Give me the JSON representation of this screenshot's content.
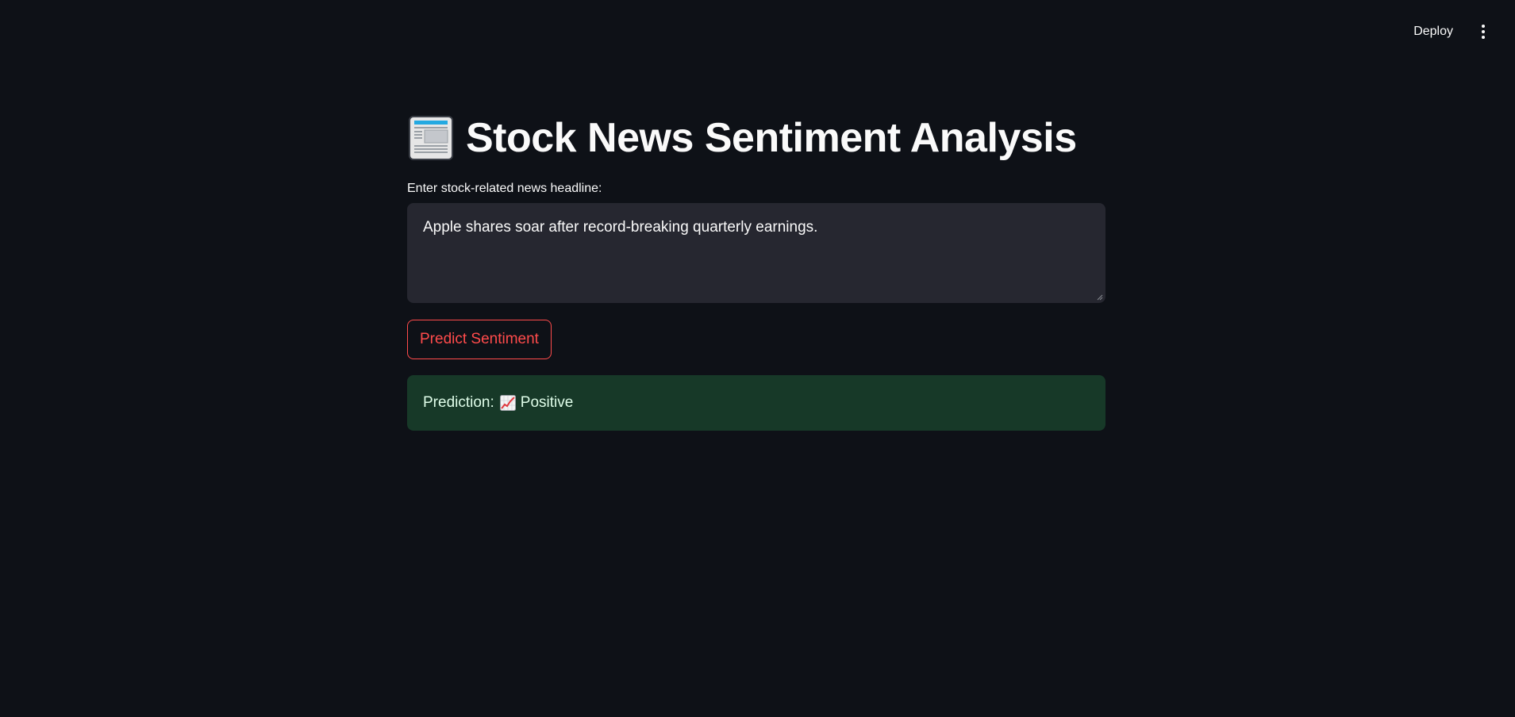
{
  "toolbar": {
    "deploy_label": "Deploy",
    "menu_icon": "kebab-menu-icon"
  },
  "main": {
    "title_icon": "newspaper-icon",
    "title": "Stock News Sentiment Analysis",
    "input_label": "Enter stock-related news headline:",
    "headline_value": "Apple shares soar after record-breaking quarterly earnings.",
    "predict_button_label": "Predict Sentiment",
    "result": {
      "prefix": "Prediction:",
      "icon": "chart-increasing-icon",
      "value": "Positive"
    }
  },
  "colors": {
    "background": "#0e1117",
    "input_background": "#262730",
    "accent": "#ff4b4b",
    "success_background": "#173928",
    "success_text": "#dffde9"
  }
}
